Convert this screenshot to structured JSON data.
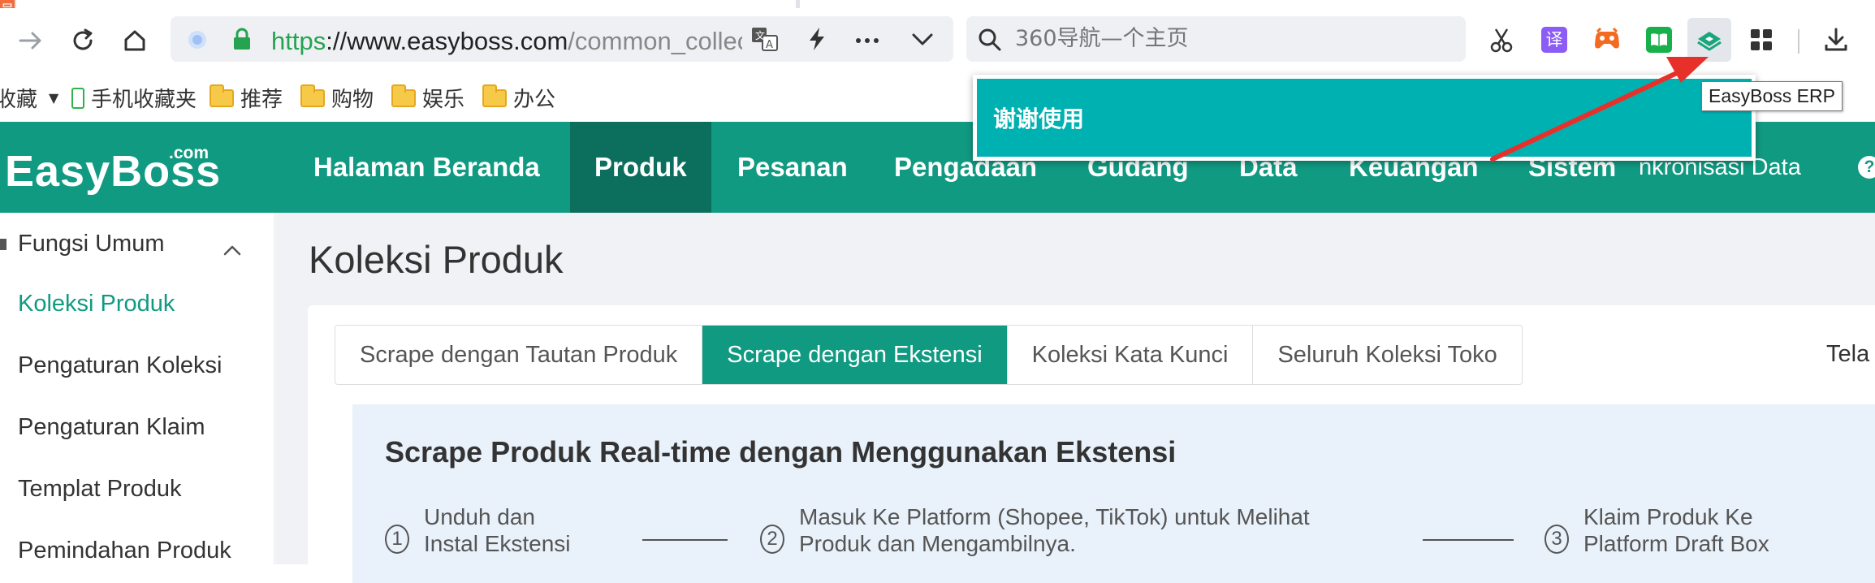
{
  "browser": {
    "corner_badge": "号",
    "url": {
      "scheme": "https",
      "separator": "://",
      "host": "www.easyboss.com",
      "path": "/common_collect"
    },
    "search": {
      "placeholder": "360导航—个主页"
    },
    "tooltip": "EasyBoss ERP",
    "icons": [
      "forward-arrow-icon",
      "reload-icon",
      "home-icon",
      "site-info-icon",
      "lock-icon",
      "translate-icon",
      "lightning-icon",
      "more-dots-icon",
      "dropdown-chevron-icon",
      "search-icon",
      "scissors-icon",
      "translator-ext-icon",
      "game-ext-icon",
      "book-ext-icon",
      "easyboss-ext-icon",
      "apps-grid-icon",
      "download-icon"
    ]
  },
  "bookmarks": {
    "items": [
      {
        "label": "收藏",
        "type": "menu"
      },
      {
        "label": "手机收藏夹",
        "type": "phone"
      },
      {
        "label": "推荐",
        "type": "folder"
      },
      {
        "label": "购物",
        "type": "folder"
      },
      {
        "label": "娱乐",
        "type": "folder"
      },
      {
        "label": "办公",
        "type": "folder"
      }
    ]
  },
  "popup": {
    "text": "谢谢使用"
  },
  "app": {
    "logo": "EasyBoss",
    "logo_suffix": ".com",
    "nav": [
      "Halaman Beranda",
      "Produk",
      "Pesanan",
      "Pengadaan",
      "Gudang",
      "Data",
      "Keuangan",
      "Sistem"
    ],
    "nav_active": "Produk",
    "nav_sync": "nkronisasi Data",
    "help": "?"
  },
  "sidebar": {
    "group": "Fungsi Umum",
    "items": [
      "Koleksi Produk",
      "Pengaturan Koleksi",
      "Pengaturan Klaim",
      "Templat Produk",
      "Pemindahan Produk"
    ],
    "active": "Koleksi Produk"
  },
  "main": {
    "title": "Koleksi Produk",
    "tabs": [
      "Scrape dengan Tautan Produk",
      "Scrape dengan Ekstensi",
      "Koleksi Kata Kunci",
      "Seluruh Koleksi Toko"
    ],
    "active_tab": "Scrape dengan Ekstensi",
    "tab_extra": "Tela",
    "info": {
      "title": "Scrape Produk Real-time dengan Menggunakan Ekstensi",
      "steps": [
        {
          "num": "1",
          "line1": "Unduh dan",
          "line2": "Instal Ekstensi"
        },
        {
          "num": "2",
          "line1": "Masuk Ke Platform (Shopee, TikTok) untuk Melihat",
          "line2": "Produk dan Mengambilnya."
        },
        {
          "num": "3",
          "line1": "Klaim Produk Ke",
          "line2": "Platform Draft Box"
        }
      ]
    }
  },
  "colors": {
    "brand": "#119a82",
    "brand_dark": "#0c6e5d",
    "popup": "#00b1b2",
    "info_bg": "#e9f1fa",
    "url_green": "#25a350",
    "arrow": "#e8302a"
  }
}
